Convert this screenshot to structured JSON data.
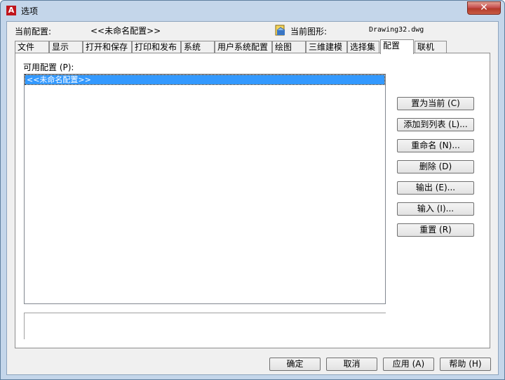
{
  "window": {
    "title": "选项",
    "app_icon_letter": "A",
    "close_label": "✕"
  },
  "header": {
    "current_profile_label": "当前配置:",
    "current_profile_value": "<<未命名配置>>",
    "current_drawing_label": "当前图形:",
    "current_drawing_value": "Drawing32.dwg"
  },
  "tabs": [
    {
      "label": "文件"
    },
    {
      "label": "显示"
    },
    {
      "label": "打开和保存"
    },
    {
      "label": "打印和发布"
    },
    {
      "label": "系统"
    },
    {
      "label": "用户系统配置"
    },
    {
      "label": "绘图"
    },
    {
      "label": "三维建模"
    },
    {
      "label": "选择集"
    },
    {
      "label": "配置",
      "active": true
    },
    {
      "label": "联机"
    }
  ],
  "profiles": {
    "label": "可用配置 (P):",
    "items": [
      "<<未命名配置>>"
    ],
    "selected_index": 0
  },
  "side_buttons": {
    "set_current": "置为当前 (C)",
    "add_to_list": "添加到列表 (L)...",
    "rename": "重命名 (N)...",
    "delete": "删除 (D)",
    "export": "输出 (E)...",
    "import": "输入 (I)...",
    "reset": "重置 (R)"
  },
  "footer": {
    "ok": "确定",
    "cancel": "取消",
    "apply": "应用 (A)",
    "help": "帮助 (H)"
  },
  "colors": {
    "selection": "#3399ff",
    "window_frame": "#c4d6ea",
    "close_button": "#c75050"
  }
}
